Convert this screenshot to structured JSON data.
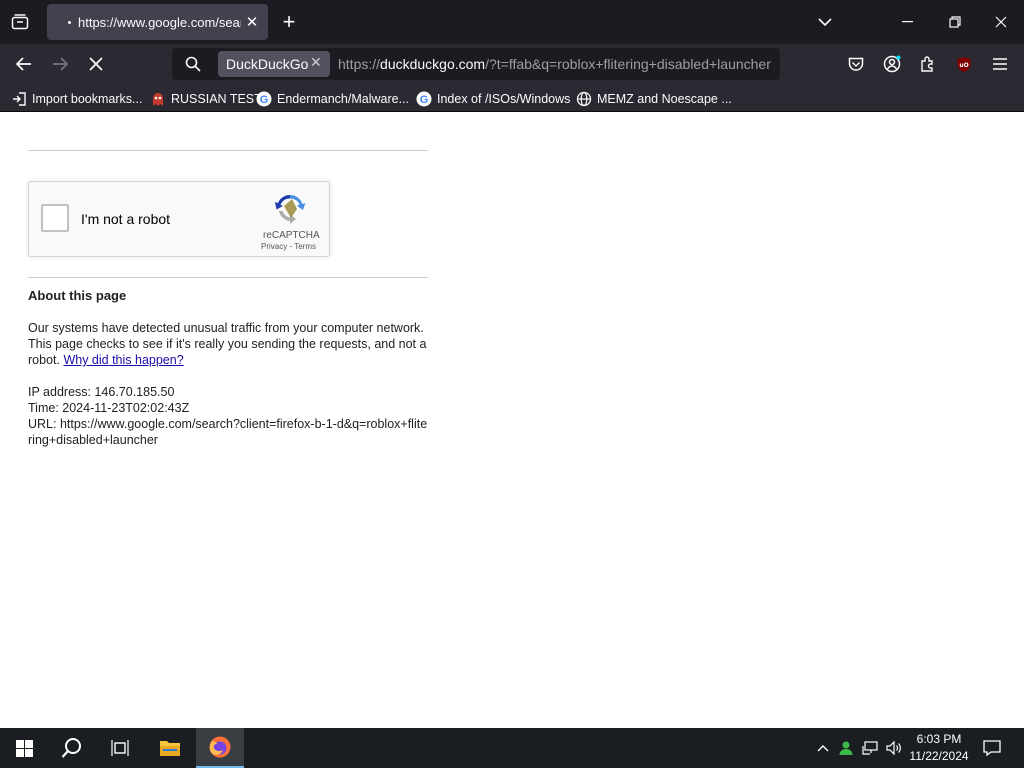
{
  "browser": {
    "tab": {
      "title": "https://www.google.com/search"
    },
    "address": {
      "engine": "DuckDuckGo",
      "url_prefix": "https://",
      "url_host": "duckduckgo.com",
      "url_rest": "/?t=ffab&q=roblox+flitering+disabled+launcher"
    },
    "bookmarks": [
      {
        "label": "Import bookmarks...",
        "icon": "import-icon"
      },
      {
        "label": "RUSSIAN TEST",
        "icon": "ghost-icon"
      },
      {
        "label": "Endermanch/Malware...",
        "icon": "google-icon"
      },
      {
        "label": "Index of /ISOs/Windows",
        "icon": "google-icon"
      },
      {
        "label": "MEMZ and Noescape ...",
        "icon": "globe-icon"
      }
    ]
  },
  "page": {
    "captcha": {
      "label": "I'm not a robot",
      "brand": "reCAPTCHA",
      "privacy": "Privacy",
      "separator": "-",
      "terms": "Terms"
    },
    "about_title": "About this page",
    "message": "Our systems have detected unusual traffic from your computer network. This page checks to see if it's really you sending the requests, and not a robot.",
    "why_link": "Why did this happen?",
    "ip_line": "IP address: 146.70.185.50",
    "time_line": "Time: 2024-11-23T02:02:43Z",
    "url_line": "URL: https://www.google.com/search?client=firefox-b-1-d&q=roblox+flitering+disabled+launcher"
  },
  "taskbar": {
    "time": "6:03 PM",
    "date": "11/22/2024"
  },
  "colors": {
    "titlebar_bg": "#1c1b22",
    "toolbar_bg": "#2b2a33",
    "taskbar_bg": "#1a1d22",
    "link": "#1a0dab"
  }
}
